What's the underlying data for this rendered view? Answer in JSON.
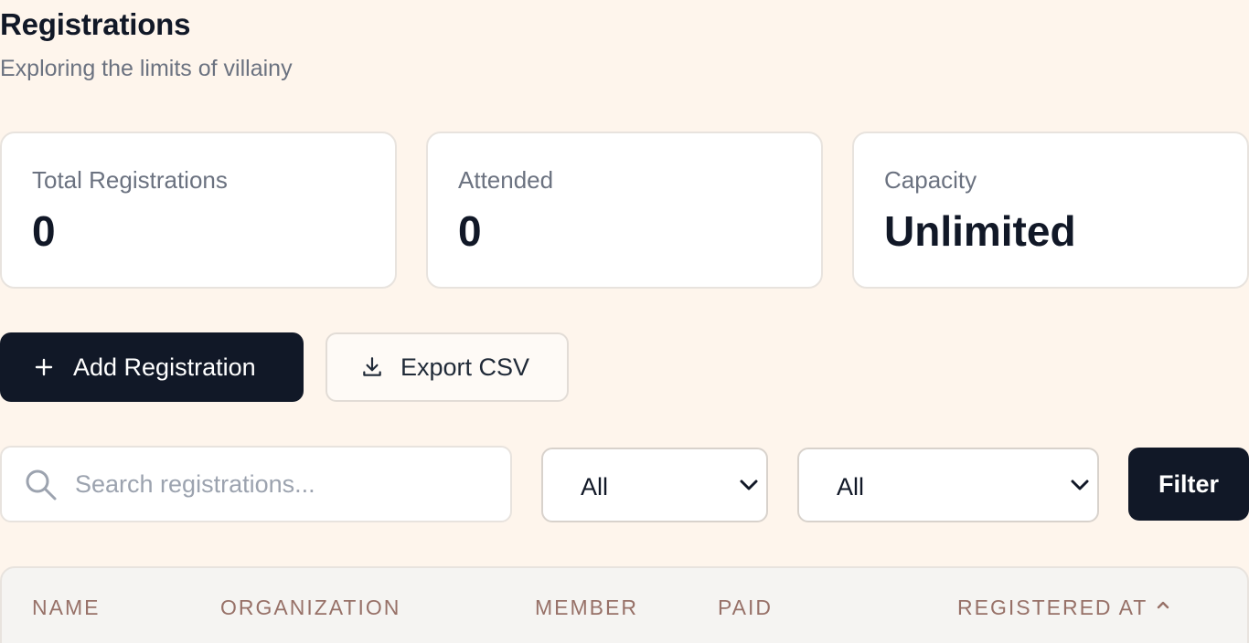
{
  "header": {
    "title": "Registrations",
    "subtitle": "Exploring the limits of villainy"
  },
  "stats": [
    {
      "label": "Total Registrations",
      "value": "0"
    },
    {
      "label": "Attended",
      "value": "0"
    },
    {
      "label": "Capacity",
      "value": "Unlimited"
    }
  ],
  "actions": {
    "add_label": "Add Registration",
    "add_icon": "plus-icon",
    "export_label": "Export CSV",
    "export_icon": "download-icon"
  },
  "filters": {
    "search_placeholder": "Search registrations...",
    "search_value": "",
    "select_1_value": "All",
    "select_2_value": "All",
    "filter_label": "Filter"
  },
  "table": {
    "columns": [
      "NAME",
      "ORGANIZATION",
      "MEMBER",
      "PAID",
      "REGISTERED AT"
    ],
    "sort_icon": "chevron-up-icon"
  },
  "colors": {
    "background": "#fef5ec",
    "primary": "#111827",
    "muted_text": "#6b7280",
    "header_text": "#977168"
  }
}
